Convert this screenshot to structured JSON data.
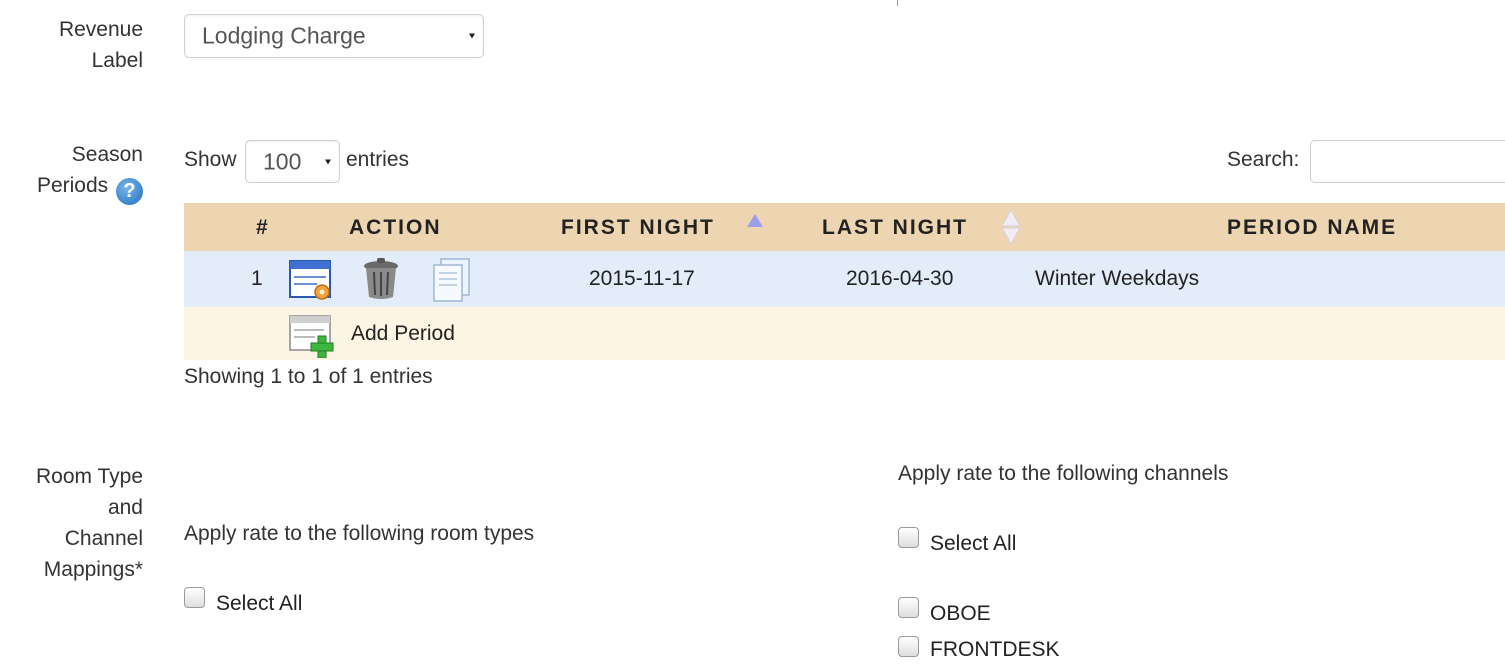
{
  "revenue": {
    "label_line1": "Revenue",
    "label_line2": "Label",
    "selected": "Lodging Charge"
  },
  "season": {
    "label_line1": "Season",
    "label_line2": "Periods",
    "show_label": "Show",
    "page_size": "100",
    "entries_label": "entries",
    "search_label": "Search:",
    "search_value": "",
    "columns": {
      "num": "#",
      "action": "ACTION",
      "first_night": "FIRST NIGHT",
      "last_night": "LAST NIGHT",
      "period_name": "PERIOD NAME"
    },
    "rows": [
      {
        "num": "1",
        "first_night": "2015-11-17",
        "last_night": "2016-04-30",
        "period_name": "Winter Weekdays"
      }
    ],
    "add_label": "Add Period",
    "info": "Showing 1 to 1 of 1 entries"
  },
  "mappings": {
    "label_line1": "Room Type",
    "label_line2": "and",
    "label_line3": "Channel",
    "label_line4": "Mappings*",
    "room_types_title": "Apply rate to the following room types",
    "room_select_all": "Select All",
    "channels_title": "Apply rate to the following channels",
    "channel_select_all": "Select All",
    "channels": [
      "OBOE",
      "FRONTDESK"
    ]
  },
  "colors": {
    "header_bg": "#ecd5b0",
    "row_bg": "#e2edf9",
    "add_row_bg": "#fdf5e3",
    "sort_icon": "#9d9de8"
  }
}
